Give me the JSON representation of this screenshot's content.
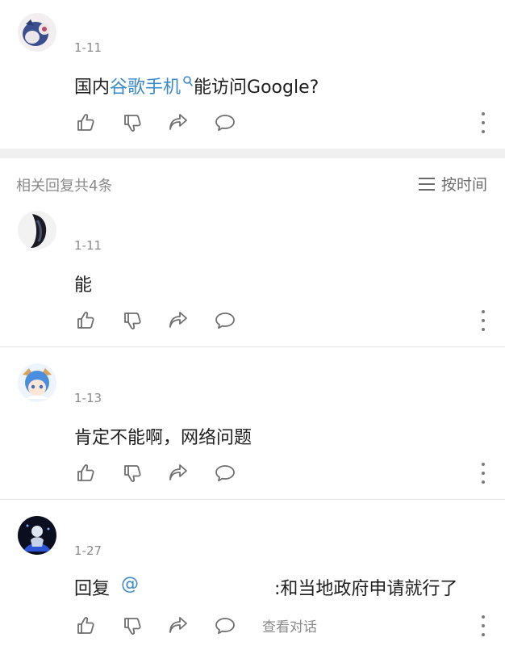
{
  "main_comment": {
    "date": "1-11",
    "text_before": "国内",
    "link_text": "谷歌手机",
    "text_after": "能访问Google?"
  },
  "replies_header": {
    "count_label": "相关回复共4条",
    "sort_label": "按时间"
  },
  "replies": [
    {
      "date": "1-11",
      "text": "能"
    },
    {
      "date": "1-13",
      "text": "肯定不能啊，网络问题"
    },
    {
      "date": "1-27",
      "reply_prefix": "回复",
      "mention": "@",
      "text": ":和当地政府申请就行了",
      "view_conversation": "查看对话"
    }
  ],
  "icons": [
    "like-icon",
    "dislike-icon",
    "share-icon",
    "comment-icon",
    "more-icon",
    "search-icon",
    "sort-icon"
  ],
  "colors": {
    "link": "#3a89c9",
    "icon": "#6f6f6f",
    "muted_text": "#8a8a8a"
  }
}
